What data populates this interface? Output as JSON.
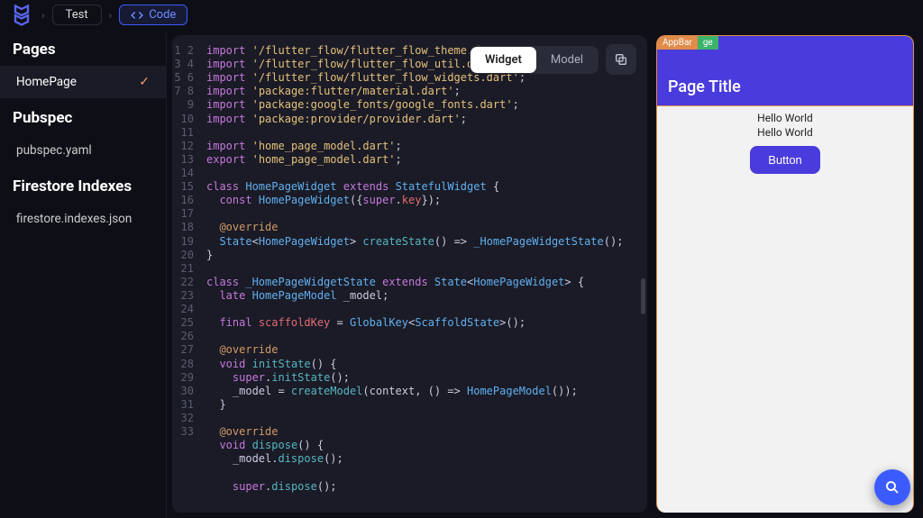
{
  "breadcrumbs": {
    "project": "Test",
    "view": "Code"
  },
  "sidebar": {
    "sections": [
      {
        "title": "Pages",
        "items": [
          {
            "label": "HomePage",
            "active": true,
            "checked": true
          }
        ]
      },
      {
        "title": "Pubspec",
        "items": [
          {
            "label": "pubspec.yaml",
            "active": false,
            "checked": false
          }
        ]
      },
      {
        "title": "Firestore Indexes",
        "items": [
          {
            "label": "firestore.indexes.json",
            "active": false,
            "checked": false
          }
        ]
      }
    ]
  },
  "editor": {
    "tabs": {
      "widget": "Widget",
      "model": "Model"
    },
    "active_tab": "widget",
    "code_lines": [
      [
        [
          "kw",
          "import"
        ],
        [
          "p",
          " "
        ],
        [
          "str",
          "'/flutter_flow/flutter_flow_theme.dart'"
        ],
        [
          "p",
          ";"
        ]
      ],
      [
        [
          "kw",
          "import"
        ],
        [
          "p",
          " "
        ],
        [
          "str",
          "'/flutter_flow/flutter_flow_util.dart'"
        ],
        [
          "p",
          ";"
        ]
      ],
      [
        [
          "kw",
          "import"
        ],
        [
          "p",
          " "
        ],
        [
          "str",
          "'/flutter_flow/flutter_flow_widgets.dart'"
        ],
        [
          "p",
          ";"
        ]
      ],
      [
        [
          "kw",
          "import"
        ],
        [
          "p",
          " "
        ],
        [
          "str",
          "'package:flutter/material.dart'"
        ],
        [
          "p",
          ";"
        ]
      ],
      [
        [
          "kw",
          "import"
        ],
        [
          "p",
          " "
        ],
        [
          "str",
          "'package:google_fonts/google_fonts.dart'"
        ],
        [
          "p",
          ";"
        ]
      ],
      [
        [
          "kw",
          "import"
        ],
        [
          "p",
          " "
        ],
        [
          "str",
          "'package:provider/provider.dart'"
        ],
        [
          "p",
          ";"
        ]
      ],
      [],
      [
        [
          "kw",
          "import"
        ],
        [
          "p",
          " "
        ],
        [
          "str",
          "'home_page_model.dart'"
        ],
        [
          "p",
          ";"
        ]
      ],
      [
        [
          "kw",
          "export"
        ],
        [
          "p",
          " "
        ],
        [
          "str",
          "'home_page_model.dart'"
        ],
        [
          "p",
          ";"
        ]
      ],
      [],
      [
        [
          "kw",
          "class"
        ],
        [
          "p",
          " "
        ],
        [
          "type",
          "HomePageWidget"
        ],
        [
          "p",
          " "
        ],
        [
          "kw",
          "extends"
        ],
        [
          "p",
          " "
        ],
        [
          "type",
          "StatefulWidget"
        ],
        [
          "p",
          " {"
        ]
      ],
      [
        [
          "p",
          "  "
        ],
        [
          "kw",
          "const"
        ],
        [
          "p",
          " "
        ],
        [
          "type",
          "HomePageWidget"
        ],
        [
          "p",
          "({"
        ],
        [
          "kw",
          "super"
        ],
        [
          "p",
          "."
        ],
        [
          "prop",
          "key"
        ],
        [
          "p",
          "});"
        ]
      ],
      [],
      [
        [
          "p",
          "  "
        ],
        [
          "ann",
          "@override"
        ]
      ],
      [
        [
          "p",
          "  "
        ],
        [
          "type",
          "State"
        ],
        [
          "p",
          "<"
        ],
        [
          "type",
          "HomePageWidget"
        ],
        [
          "p",
          "> "
        ],
        [
          "fn",
          "createState"
        ],
        [
          "p",
          "() => "
        ],
        [
          "type",
          "_HomePageWidgetState"
        ],
        [
          "p",
          "();"
        ]
      ],
      [
        [
          "p",
          "}"
        ]
      ],
      [],
      [
        [
          "kw",
          "class"
        ],
        [
          "p",
          " "
        ],
        [
          "type",
          "_HomePageWidgetState"
        ],
        [
          "p",
          " "
        ],
        [
          "kw",
          "extends"
        ],
        [
          "p",
          " "
        ],
        [
          "type",
          "State"
        ],
        [
          "p",
          "<"
        ],
        [
          "type",
          "HomePageWidget"
        ],
        [
          "p",
          "> {"
        ]
      ],
      [
        [
          "p",
          "  "
        ],
        [
          "kw",
          "late"
        ],
        [
          "p",
          " "
        ],
        [
          "type",
          "HomePageModel"
        ],
        [
          "p",
          " _model;"
        ]
      ],
      [],
      [
        [
          "p",
          "  "
        ],
        [
          "kw",
          "final"
        ],
        [
          "p",
          " "
        ],
        [
          "prop",
          "scaffoldKey"
        ],
        [
          "p",
          " = "
        ],
        [
          "type",
          "GlobalKey"
        ],
        [
          "p",
          "<"
        ],
        [
          "type",
          "ScaffoldState"
        ],
        [
          "p",
          ">();"
        ]
      ],
      [],
      [
        [
          "p",
          "  "
        ],
        [
          "ann",
          "@override"
        ]
      ],
      [
        [
          "p",
          "  "
        ],
        [
          "kw",
          "void"
        ],
        [
          "p",
          " "
        ],
        [
          "fn",
          "initState"
        ],
        [
          "p",
          "() {"
        ]
      ],
      [
        [
          "p",
          "    "
        ],
        [
          "kw",
          "super"
        ],
        [
          "p",
          "."
        ],
        [
          "fn",
          "initState"
        ],
        [
          "p",
          "();"
        ]
      ],
      [
        [
          "p",
          "    _model = "
        ],
        [
          "fn",
          "createModel"
        ],
        [
          "p",
          "(context, () => "
        ],
        [
          "type",
          "HomePageModel"
        ],
        [
          "p",
          "());"
        ]
      ],
      [
        [
          "p",
          "  }"
        ]
      ],
      [],
      [
        [
          "p",
          "  "
        ],
        [
          "ann",
          "@override"
        ]
      ],
      [
        [
          "p",
          "  "
        ],
        [
          "kw",
          "void"
        ],
        [
          "p",
          " "
        ],
        [
          "fn",
          "dispose"
        ],
        [
          "p",
          "() {"
        ]
      ],
      [
        [
          "p",
          "    _model."
        ],
        [
          "fn",
          "dispose"
        ],
        [
          "p",
          "();"
        ]
      ],
      [],
      [
        [
          "p",
          "    "
        ],
        [
          "kw",
          "super"
        ],
        [
          "p",
          "."
        ],
        [
          "fn",
          "dispose"
        ],
        [
          "p",
          "();"
        ]
      ]
    ]
  },
  "preview": {
    "tags": [
      "AppBar",
      "ge"
    ],
    "appbar_title": "Page Title",
    "body_texts": [
      "Hello World",
      "Hello World"
    ],
    "button_label": "Button"
  }
}
